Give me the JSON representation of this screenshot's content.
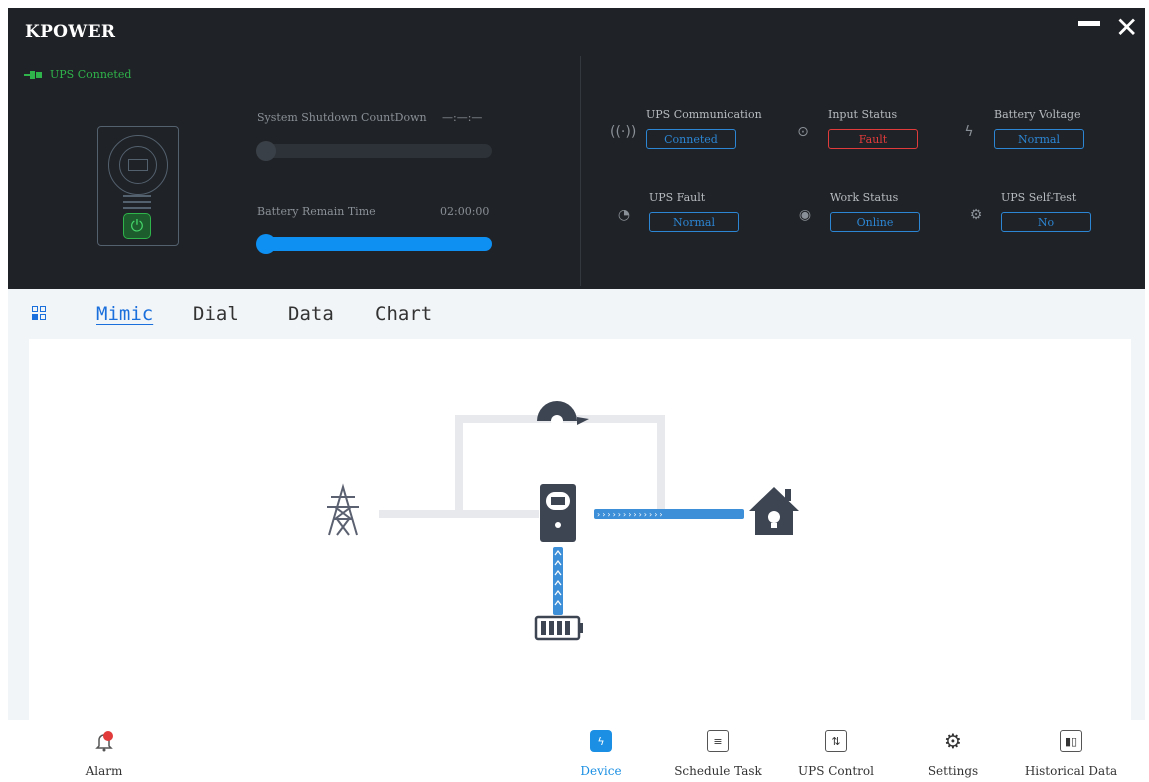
{
  "app": {
    "title": "KPOWER"
  },
  "window_controls": {
    "minimize": "—",
    "close": "✕"
  },
  "connection": {
    "status": "UPS Conneted",
    "color": "#2fb34b"
  },
  "countdown": {
    "label": "System Shutdown CountDown",
    "value": "—:—:—",
    "progress": 0.0
  },
  "battery": {
    "label": "Battery Remain Time",
    "value": "02:00:00",
    "progress": 1.0
  },
  "status_panel": [
    {
      "title": "UPS Communication",
      "value": "Conneted",
      "icon": "signal-icon",
      "state": "normal"
    },
    {
      "title": "Input Status",
      "value": "Fault",
      "icon": "sine-wave-icon",
      "state": "fault"
    },
    {
      "title": "Battery Voltage",
      "value": "Normal",
      "icon": "battery-charge-icon",
      "state": "normal"
    },
    {
      "title": "UPS Fault",
      "value": "Normal",
      "icon": "fault-gauge-icon",
      "state": "normal"
    },
    {
      "title": "Work Status",
      "value": "Online",
      "icon": "power-drop-icon",
      "state": "normal"
    },
    {
      "title": "UPS Self-Test",
      "value": "No",
      "icon": "self-test-icon",
      "state": "normal"
    }
  ],
  "tabs": {
    "items": [
      "Mimic",
      "Dial",
      "Data",
      "Chart"
    ],
    "active": "Mimic"
  },
  "bottom_nav": {
    "alarm": "Alarm",
    "items": [
      "Device",
      "Schedule Task",
      "UPS Control",
      "Settings",
      "Historical Data"
    ],
    "active": "Device"
  },
  "colors": {
    "accent": "#1a6fdc",
    "fault": "#e23b3b",
    "ok": "#2fb34b",
    "flow": "#3d8fd8",
    "header_bg": "#1f2226"
  }
}
